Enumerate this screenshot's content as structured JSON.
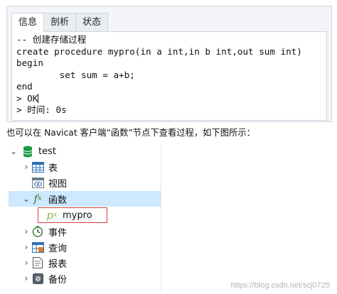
{
  "tabs": [
    {
      "label": "信息",
      "active": true
    },
    {
      "label": "剖析",
      "active": false
    },
    {
      "label": "状态",
      "active": false
    }
  ],
  "editor_lines": [
    "-- 创建存储过程",
    "create procedure mypro(in a int,in b int,out sum int)",
    "begin",
    "        set sum = a+b;",
    "end",
    "> OK",
    "> 时间: 0s"
  ],
  "caption": "也可以在 Navicat 客户端“函数”节点下查看过程，如下图所示：",
  "tree": {
    "database": "test",
    "nodes": [
      {
        "label": "表",
        "icon": "table-icon",
        "chevron": "›"
      },
      {
        "label": "视图",
        "icon": "view-icon",
        "chevron": ""
      },
      {
        "label": "函数",
        "icon": "function-icon",
        "chevron": "⌄"
      },
      {
        "label": "mypro",
        "icon": "procedure-icon",
        "chevron": ""
      },
      {
        "label": "事件",
        "icon": "clock-icon",
        "chevron": "›"
      },
      {
        "label": "查询",
        "icon": "query-icon",
        "chevron": "›"
      },
      {
        "label": "报表",
        "icon": "report-icon",
        "chevron": "›"
      },
      {
        "label": "备份",
        "icon": "backup-icon",
        "chevron": "›"
      }
    ]
  },
  "colors": {
    "selected_row": "#cde8ff",
    "highlight_border": "#d64040",
    "db_icon": "#1f9a45"
  },
  "watermark": "https://blog.csdn.net/scj0725"
}
